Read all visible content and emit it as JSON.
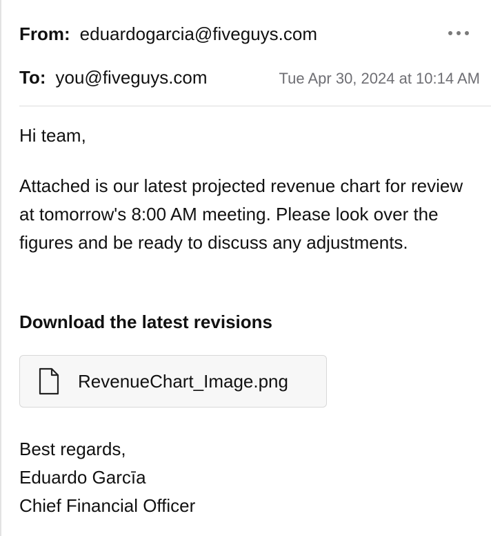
{
  "header": {
    "from_label": "From:",
    "from_address": "eduardogarcia@fiveguys.com",
    "to_label": "To:",
    "to_address": "you@fiveguys.com",
    "date": "Tue Apr 30, 2024 at 10:14 AM",
    "more_icon": "more-horizontal-icon"
  },
  "body": {
    "greeting": "Hi team,",
    "paragraph": "Attached is our latest projected revenue chart for review at tomorrow's 8:00 AM meeting. Please look over the figures and be ready to discuss any adjustments.",
    "download_heading": "Download the latest revisions"
  },
  "attachment": {
    "icon": "document-icon",
    "file_name": "RevenueChart_Image.png"
  },
  "signature": {
    "closing": "Best regards,",
    "name": "Eduardo Garcīa",
    "title": "Chief Financial Officer"
  },
  "colors": {
    "text": "#111111",
    "muted": "#6e6e73",
    "divider": "#dcdcdc",
    "attachment_bg": "#f7f7f7"
  }
}
